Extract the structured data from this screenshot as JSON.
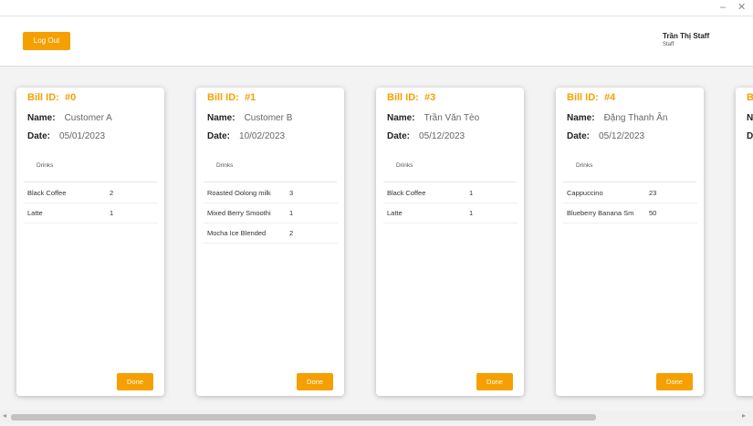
{
  "window": {
    "minimize_glyph": "–",
    "close_glyph": "✕"
  },
  "header": {
    "logout_label": "Log Out",
    "user_name": "Trần Thị Staff",
    "user_role": "Staff"
  },
  "bills": [
    {
      "id_label": "Bill ID:",
      "id": "#0",
      "name_label": "Name:",
      "name": "Customer A",
      "date_label": "Date:",
      "date": "05/01/2023",
      "drinks_label": "Drinks",
      "items": [
        {
          "name": "Black Coffee",
          "qty": "2"
        },
        {
          "name": "Latte",
          "qty": "1"
        }
      ],
      "done_label": "Done"
    },
    {
      "id_label": "Bill ID:",
      "id": "#1",
      "name_label": "Name:",
      "name": "Customer B",
      "date_label": "Date:",
      "date": "10/02/2023",
      "drinks_label": "Drinks",
      "items": [
        {
          "name": "Roasted Oolong milk",
          "qty": "3"
        },
        {
          "name": "Mixed Berry Smoothi",
          "qty": "1"
        },
        {
          "name": "Mocha Ice Blended",
          "qty": "2"
        }
      ],
      "done_label": "Done"
    },
    {
      "id_label": "Bill ID:",
      "id": "#3",
      "name_label": "Name:",
      "name": "Trần Văn Tèo",
      "date_label": "Date:",
      "date": "05/12/2023",
      "drinks_label": "Drinks",
      "items": [
        {
          "name": "Black Coffee",
          "qty": "1"
        },
        {
          "name": "Latte",
          "qty": "1"
        }
      ],
      "done_label": "Done"
    },
    {
      "id_label": "Bill ID:",
      "id": "#4",
      "name_label": "Name:",
      "name": "Đặng Thanh Ân",
      "date_label": "Date:",
      "date": "05/12/2023",
      "drinks_label": "Drinks",
      "items": [
        {
          "name": "Cappuccino",
          "qty": "23"
        },
        {
          "name": "Blueberry Banana Sm",
          "qty": "50"
        }
      ],
      "done_label": "Done"
    },
    {
      "id_label": "Bill ID:",
      "id": "",
      "name_label": "Name:",
      "name": "",
      "date_label": "Date:",
      "date": "",
      "drinks_label": "",
      "items": [],
      "done_label": ""
    }
  ],
  "scrollbar": {
    "left_arrow": "◂",
    "right_arrow": "▸"
  },
  "colors": {
    "accent": "#f5a000",
    "background": "#f3f3f3"
  }
}
